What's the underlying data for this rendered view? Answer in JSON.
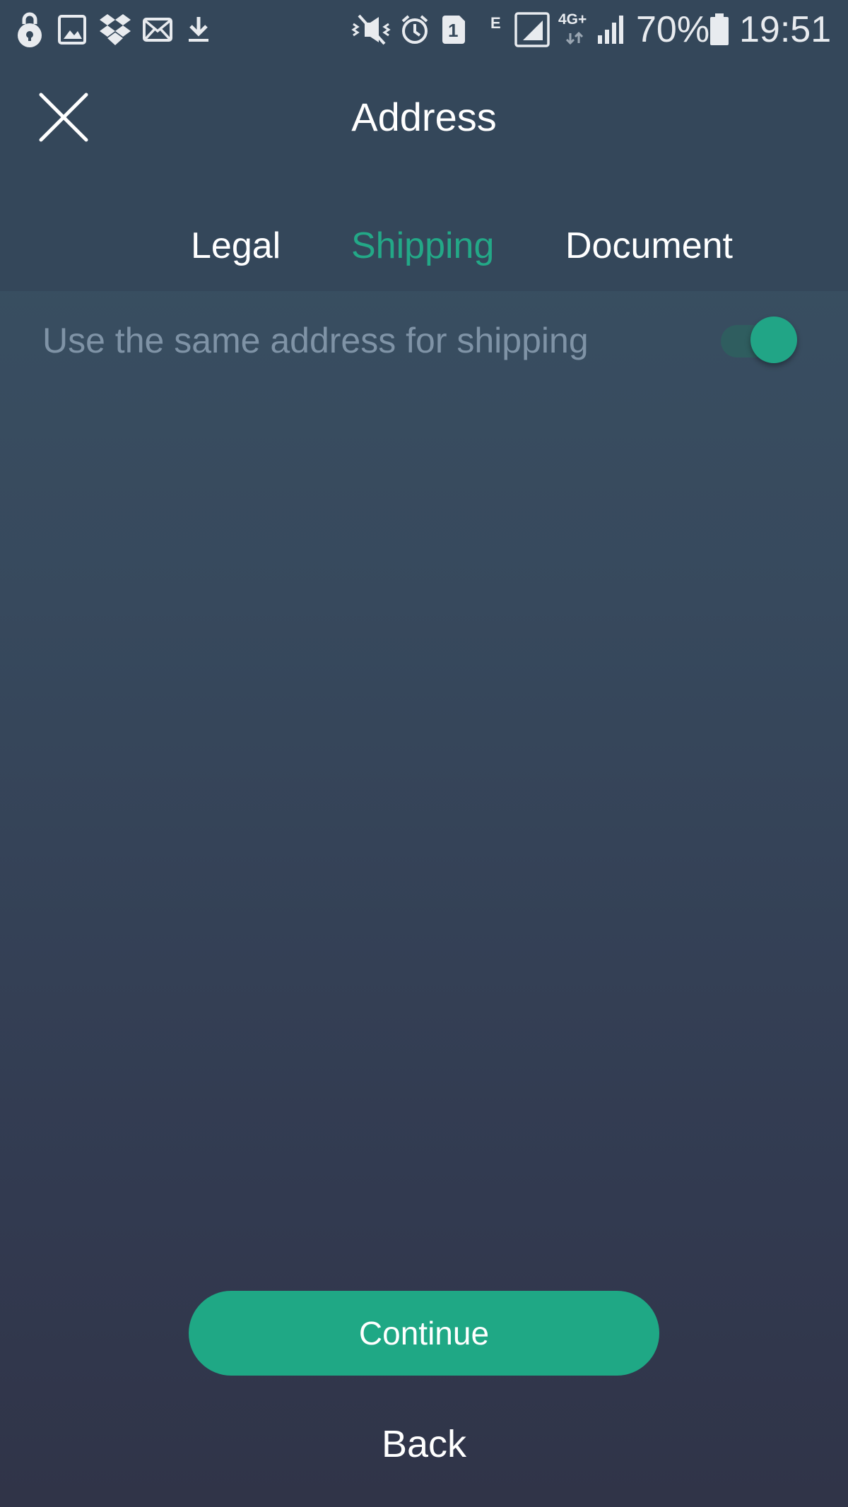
{
  "status_bar": {
    "battery_percent": "70%",
    "time": "19:51",
    "network_type": "4G+",
    "edge_indicator": "E",
    "sim_slot": "1",
    "left_icons": [
      "lock-icon",
      "image-icon",
      "dropbox-icon",
      "mail-icon",
      "download-icon"
    ],
    "right_icons": [
      "mute-icon",
      "alarm-icon",
      "sim-icon",
      "signal-icon",
      "signal-icon",
      "battery-icon"
    ]
  },
  "header": {
    "title": "Address",
    "close_icon": "close-icon"
  },
  "tabs": [
    {
      "label": "Legal",
      "active": false
    },
    {
      "label": "Shipping",
      "active": true
    },
    {
      "label": "Document",
      "active": false
    }
  ],
  "shipping": {
    "same_address_label": "Use the same address for shipping",
    "same_address_enabled": true
  },
  "actions": {
    "continue_label": "Continue",
    "back_label": "Back"
  },
  "colors": {
    "accent": "#1fa885",
    "background_top": "#3a5264",
    "background_bottom": "#303448",
    "muted_text": "#7f93a6"
  }
}
